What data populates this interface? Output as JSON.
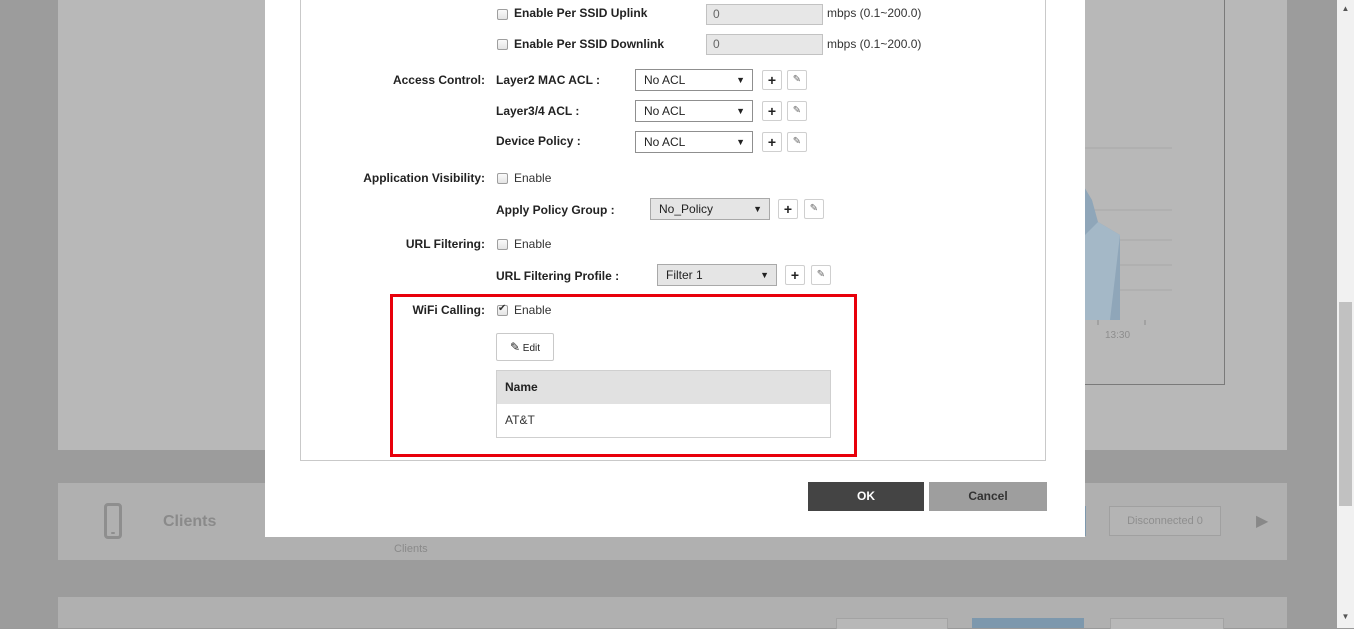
{
  "background": {
    "chart_time_label": "13:30",
    "clients_title": "Clients",
    "clients_subtitle": "Clients",
    "disconnected_label": "Disconnected 0",
    "play_icon": "play-icon"
  },
  "modal": {
    "per_ssid_uplink": {
      "label": "Enable Per SSID Uplink",
      "value": "0",
      "unit": "mbps (0.1~200.0)",
      "checked": false
    },
    "per_ssid_downlink": {
      "label": "Enable Per SSID Downlink",
      "value": "0",
      "unit": "mbps (0.1~200.0)",
      "checked": false
    },
    "access_control": {
      "label": "Access Control:",
      "layer2_label": "Layer2 MAC ACL :",
      "layer2_value": "No ACL",
      "layer34_label": "Layer3/4 ACL :",
      "layer34_value": "No ACL",
      "device_label": "Device Policy :",
      "device_value": "No ACL"
    },
    "app_visibility": {
      "label": "Application Visibility:",
      "enable_label": "Enable",
      "checked": false,
      "policy_group_label": "Apply Policy Group :",
      "policy_group_value": "No_Policy"
    },
    "url_filtering": {
      "label": "URL Filtering:",
      "enable_label": "Enable",
      "checked": false,
      "profile_label": "URL Filtering Profile :",
      "profile_value": "Filter 1"
    },
    "wifi_calling": {
      "label": "WiFi Calling:",
      "enable_label": "Enable",
      "checked": true,
      "edit_label": "Edit",
      "table_header": "Name",
      "rows": [
        "AT&T"
      ]
    },
    "ok_label": "OK",
    "cancel_label": "Cancel",
    "add_symbol": "+",
    "edit_symbol": "✎",
    "caret": "▼"
  },
  "colors": {
    "highlight": "#e8000b",
    "ok_bg": "#444444",
    "cancel_bg": "#9e9e9e"
  }
}
